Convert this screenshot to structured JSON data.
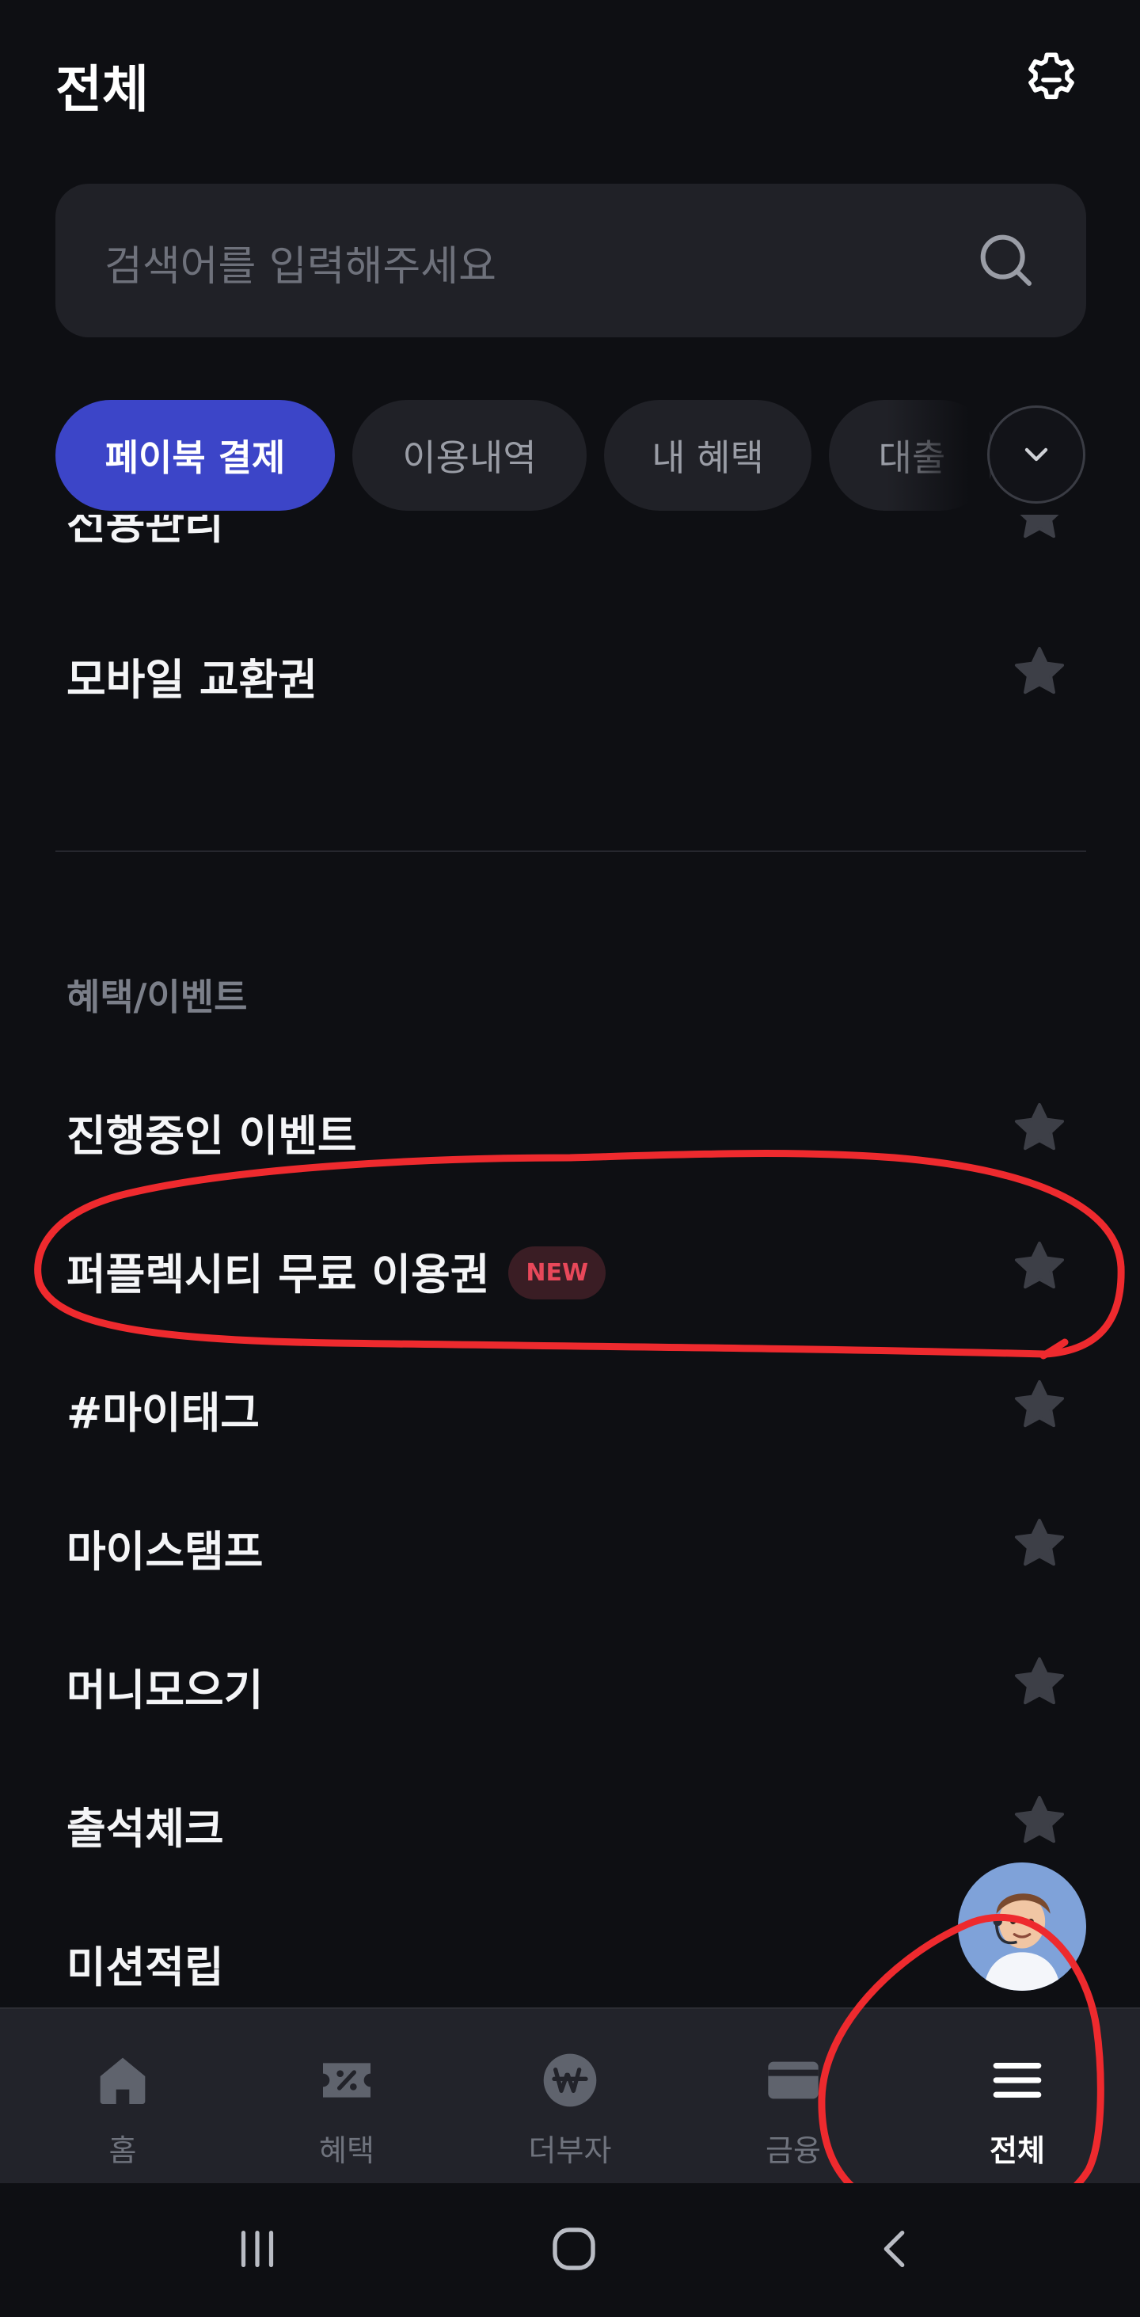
{
  "header": {
    "title": "전체",
    "settings_icon": "gear-icon"
  },
  "search": {
    "placeholder": "검색어를 입력해주세요",
    "icon": "search-icon"
  },
  "chips": [
    {
      "label": "페이북 결제",
      "active": true
    },
    {
      "label": "이용내역",
      "active": false
    },
    {
      "label": "내 혜택",
      "active": false
    },
    {
      "label": "대출",
      "active": false
    }
  ],
  "chips_more_icon": "chevron-down-icon",
  "menu_top": [
    {
      "label": "전용관리",
      "favorite_icon": "star-icon"
    },
    {
      "label": "모바일 교환권",
      "favorite_icon": "star-icon"
    }
  ],
  "section": {
    "title": "혜택/이벤트",
    "items": [
      {
        "label": "진행중인 이벤트",
        "badge": ""
      },
      {
        "label": "퍼플렉시티 무료 이용권",
        "badge": "NEW"
      },
      {
        "label": "#마이태그",
        "badge": ""
      },
      {
        "label": "마이스탬프",
        "badge": ""
      },
      {
        "label": "머니모으기",
        "badge": ""
      },
      {
        "label": "출석체크",
        "badge": ""
      },
      {
        "label": "미션적립",
        "badge": ""
      }
    ]
  },
  "chatbot_icon": "assistant-avatar-icon",
  "tabbar": [
    {
      "label": "홈",
      "icon": "home-icon",
      "active": false
    },
    {
      "label": "혜택",
      "icon": "coupon-icon",
      "active": false
    },
    {
      "label": "더부자",
      "icon": "won-icon",
      "active": false
    },
    {
      "label": "금융",
      "icon": "card-icon",
      "active": false
    },
    {
      "label": "전체",
      "icon": "menu-icon",
      "active": true
    }
  ],
  "system_nav": [
    "recent-apps-icon",
    "home-circle-icon",
    "back-icon"
  ],
  "colors": {
    "background": "#0e0f13",
    "accent": "#3c45c8",
    "badge_new": "#e8485a",
    "annotation": "#ee2a2e"
  }
}
